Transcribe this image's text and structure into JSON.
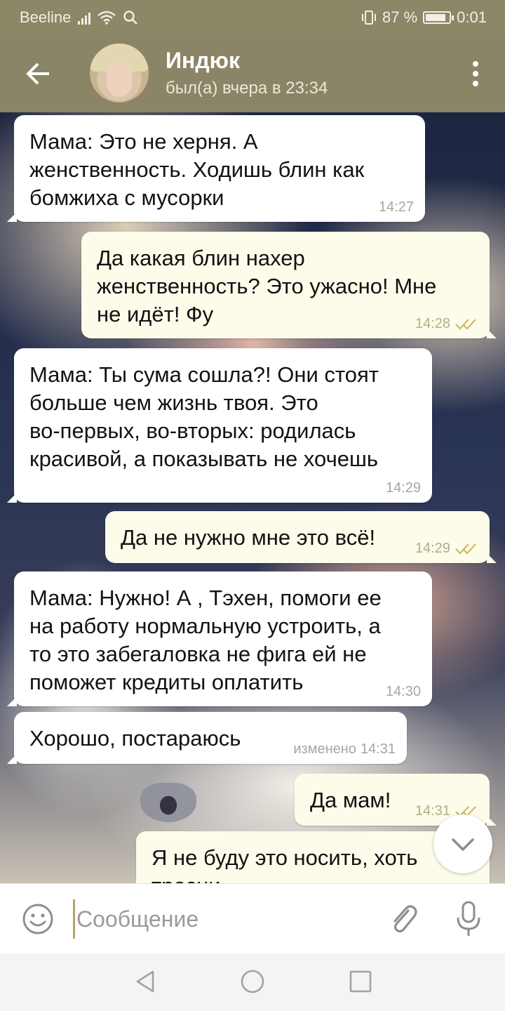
{
  "status_bar": {
    "carrier": "Beeline",
    "battery_percent": "87 %",
    "time": "0:01",
    "battery_level": 0.87
  },
  "header": {
    "title": "Индюк",
    "subtitle": "был(а) вчера в 23:34",
    "icons": {
      "back": "arrow-left-icon",
      "menu": "more-vertical-icon"
    }
  },
  "messages": [
    {
      "direction": "in",
      "text": "Мама: Это не херня. А\nженственность. Ходишь блин как\nбомжиха с мусорки",
      "time": "14:27",
      "read": false,
      "edited_label": ""
    },
    {
      "direction": "out",
      "text": "Да какая блин нахер\nженственность? Это ужасно! Мне\nне идёт! Фу",
      "time": "14:28",
      "read": true,
      "edited_label": ""
    },
    {
      "direction": "in",
      "text": "Мама: Ты сума сошла?! Они стоят\nбольше чем жизнь твоя. Это\nво-первых, во-вторых: родилась\nкрасивой, а показывать не хочешь",
      "time": "14:29",
      "read": false,
      "edited_label": ""
    },
    {
      "direction": "out",
      "text": "Да не нужно мне это всё!",
      "time": "14:29",
      "read": true,
      "edited_label": ""
    },
    {
      "direction": "in",
      "text": "Мама: Нужно! А , Тэхен, помоги ее\nна работу нормальную устроить, а\nто это забегаловка не фига ей не\nпоможет кредиты оплатить",
      "time": "14:30",
      "read": false,
      "edited_label": ""
    },
    {
      "direction": "in",
      "text": "Хорошо, постараюсь",
      "time": "14:31",
      "read": false,
      "edited_label": "изменено"
    },
    {
      "direction": "out",
      "text": "Да мам!",
      "time": "14:31",
      "read": true,
      "edited_label": ""
    },
    {
      "direction": "out",
      "text": "Я не буду это носить, хоть\nтресни",
      "time": "",
      "read": false,
      "edited_label": ""
    }
  ],
  "input": {
    "placeholder": "Сообщение",
    "value": ""
  },
  "icons": {
    "emoji": "smile-icon",
    "attach": "paperclip-icon",
    "mic": "microphone-icon",
    "scroll_down": "chevron-down-icon",
    "nav_back": "triangle-back-icon",
    "nav_home": "circle-home-icon",
    "nav_recent": "square-recent-icon"
  },
  "colors": {
    "header": "#8a8566",
    "outgoing_bubble": "#fdfbe9",
    "incoming_bubble": "#ffffff",
    "read_checks": "#c9b65a",
    "cursor": "#b5a46a"
  }
}
